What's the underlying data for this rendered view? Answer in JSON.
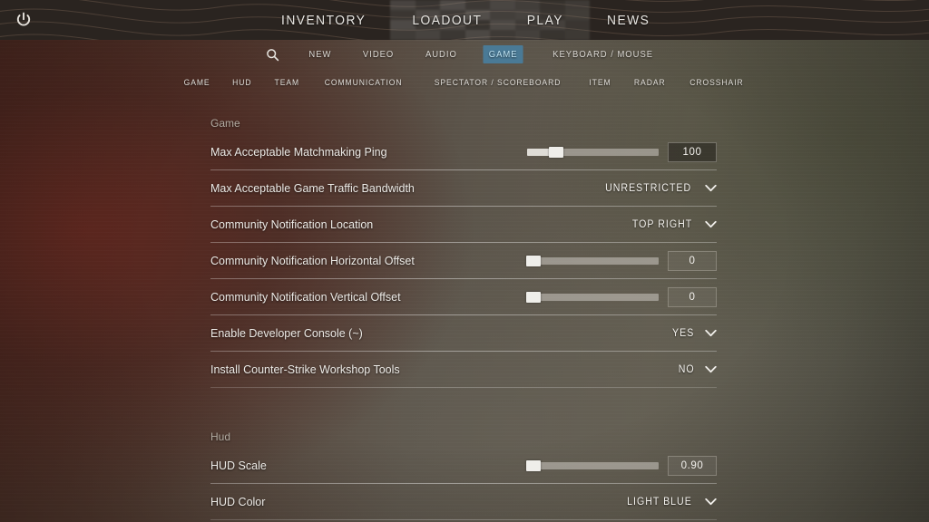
{
  "window": {
    "power_icon": "power-icon"
  },
  "main_nav": {
    "items": [
      {
        "label": "INVENTORY"
      },
      {
        "label": "LOADOUT"
      },
      {
        "label": "PLAY"
      },
      {
        "label": "NEWS"
      }
    ]
  },
  "settings_tabs": {
    "search_icon": "search-icon",
    "items": [
      {
        "label": "NEW",
        "active": false
      },
      {
        "label": "VIDEO",
        "active": false
      },
      {
        "label": "AUDIO",
        "active": false
      },
      {
        "label": "GAME",
        "active": true
      },
      {
        "label": "KEYBOARD / MOUSE",
        "active": false
      }
    ],
    "active_color": "#4a7a96",
    "active_text_color": "#bfe4f5"
  },
  "sub_tabs": {
    "items": [
      {
        "label": "GAME"
      },
      {
        "label": "HUD"
      },
      {
        "label": "TEAM"
      },
      {
        "label": "COMMUNICATION"
      },
      {
        "label": "SPECTATOR / SCOREBOARD"
      },
      {
        "label": "ITEM"
      },
      {
        "label": "RADAR"
      },
      {
        "label": "CROSSHAIR"
      }
    ]
  },
  "sections": [
    {
      "title": "Game",
      "rows": [
        {
          "label": "Max Acceptable Matchmaking Ping",
          "type": "slider",
          "value": "100",
          "percent": 22,
          "box_style": "dark"
        },
        {
          "label": "Max Acceptable Game Traffic Bandwidth",
          "type": "dropdown",
          "value": "UNRESTRICTED"
        },
        {
          "label": "Community Notification Location",
          "type": "dropdown",
          "value": "TOP RIGHT"
        },
        {
          "label": "Community Notification Horizontal Offset",
          "type": "slider",
          "value": "0",
          "percent": 4,
          "box_style": "light"
        },
        {
          "label": "Community Notification Vertical Offset",
          "type": "slider",
          "value": "0",
          "percent": 4,
          "box_style": "light"
        },
        {
          "label": "Enable Developer Console (~)",
          "type": "dropdown",
          "value": "YES"
        },
        {
          "label": "Install Counter-Strike Workshop Tools",
          "type": "dropdown",
          "value": "NO"
        }
      ]
    },
    {
      "title": "Hud",
      "rows": [
        {
          "label": "HUD Scale",
          "type": "slider",
          "value": "0.90",
          "percent": 5,
          "box_style": "light"
        },
        {
          "label": "HUD Color",
          "type": "dropdown",
          "value": "LIGHT BLUE"
        }
      ]
    }
  ]
}
